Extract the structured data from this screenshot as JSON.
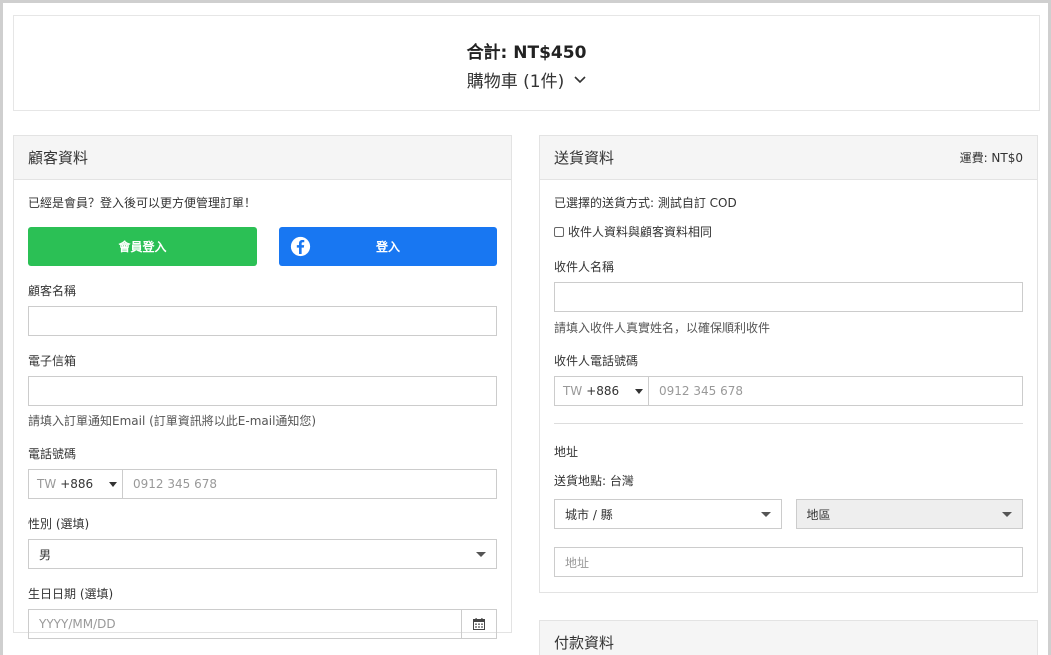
{
  "summary": {
    "total_label": "合計: NT$450",
    "cart_label": "購物車 (1件)"
  },
  "customer": {
    "title": "顧客資料",
    "member_prompt": "已經是會員？登入後可以更方便管理訂單！",
    "member_login_label": "會員登入",
    "fb_login_label": "登入",
    "name_label": "顧客名稱",
    "name_value": "",
    "email_label": "電子信箱",
    "email_value": "",
    "email_help": "請填入訂單通知Email (訂單資訊將以此E-mail通知您)",
    "phone_label": "電話號碼",
    "phone_country": "TW",
    "phone_code": "+886",
    "phone_placeholder": "0912 345 678",
    "gender_label": "性別 (選填)",
    "gender_value": "男",
    "birthday_label": "生日日期 (選填)",
    "birthday_placeholder": "YYYY/MM/DD"
  },
  "delivery": {
    "title": "送貨資料",
    "shipping_fee": "運費: NT$0",
    "method_text": "已選擇的送貨方式: 測試自訂 COD",
    "same_as_customer_label": "收件人資料與顧客資料相同",
    "recipient_name_label": "收件人名稱",
    "recipient_name_value": "",
    "recipient_name_help": "請填入收件人真實姓名，以確保順利收件",
    "recipient_phone_label": "收件人電話號碼",
    "phone_country": "TW",
    "phone_code": "+886",
    "phone_placeholder": "0912 345 678",
    "address_label": "地址",
    "location_text": "送貨地點: 台灣",
    "city_placeholder": "城市 / 縣",
    "district_placeholder": "地區",
    "address_placeholder": "地址"
  },
  "payment": {
    "title": "付款資料"
  },
  "colors": {
    "member_button": "#2bc055",
    "facebook_button": "#1877f2",
    "panel_header_bg": "#f5f5f5"
  }
}
